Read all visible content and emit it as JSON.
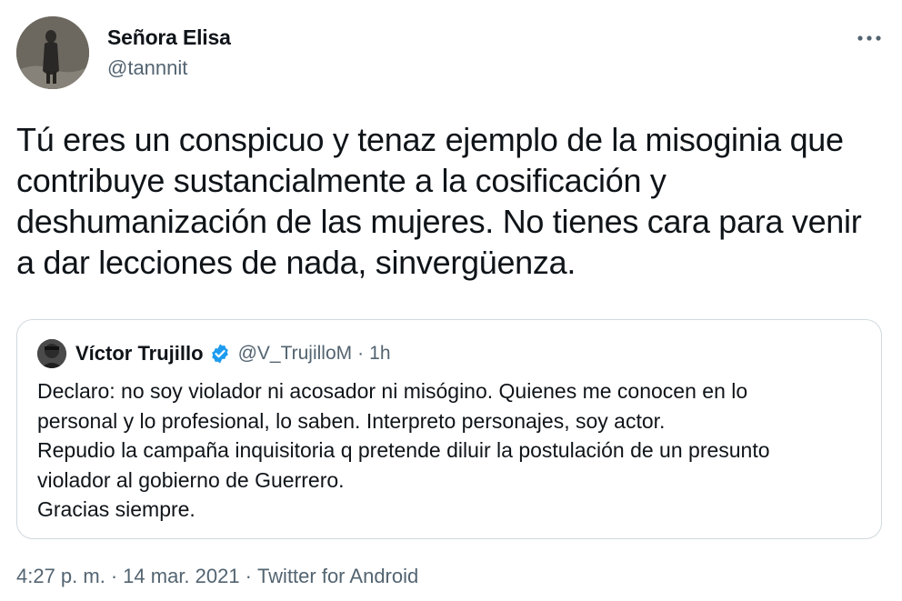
{
  "tweet": {
    "author": {
      "display_name": "Señora Elisa",
      "handle": "@tannnit"
    },
    "more_icon": "more-horizontal-icon",
    "text": "Tú eres un conspicuo y tenaz ejemplo de la misoginia que contribuye sustancialmente a la cosificación y deshumanización de las mujeres. No tienes cara para venir a dar lecciones de nada, sinvergüenza.",
    "quoted": {
      "display_name": "Víctor Trujillo",
      "verified": true,
      "handle": "@V_TrujilloM",
      "separator": "·",
      "time": "1h",
      "lines": [
        "Declaro: no soy violador ni acosador ni misógino. Quienes me conocen en lo",
        "personal y lo profesional, lo saben. Interpreto personajes, soy actor.",
        "Repudio la campaña inquisitoria q pretende diluir la postulación de un presunto",
        "violador al gobierno de Guerrero.",
        "Gracias siempre."
      ]
    },
    "meta": {
      "time": "4:27 p. m.",
      "date": "14 mar. 2021",
      "source": "Twitter for Android",
      "separator": "·"
    }
  },
  "colors": {
    "text_primary": "#0f1419",
    "text_secondary": "#536471",
    "verified_blue": "#1d9bf0",
    "border": "#cfd9de"
  }
}
